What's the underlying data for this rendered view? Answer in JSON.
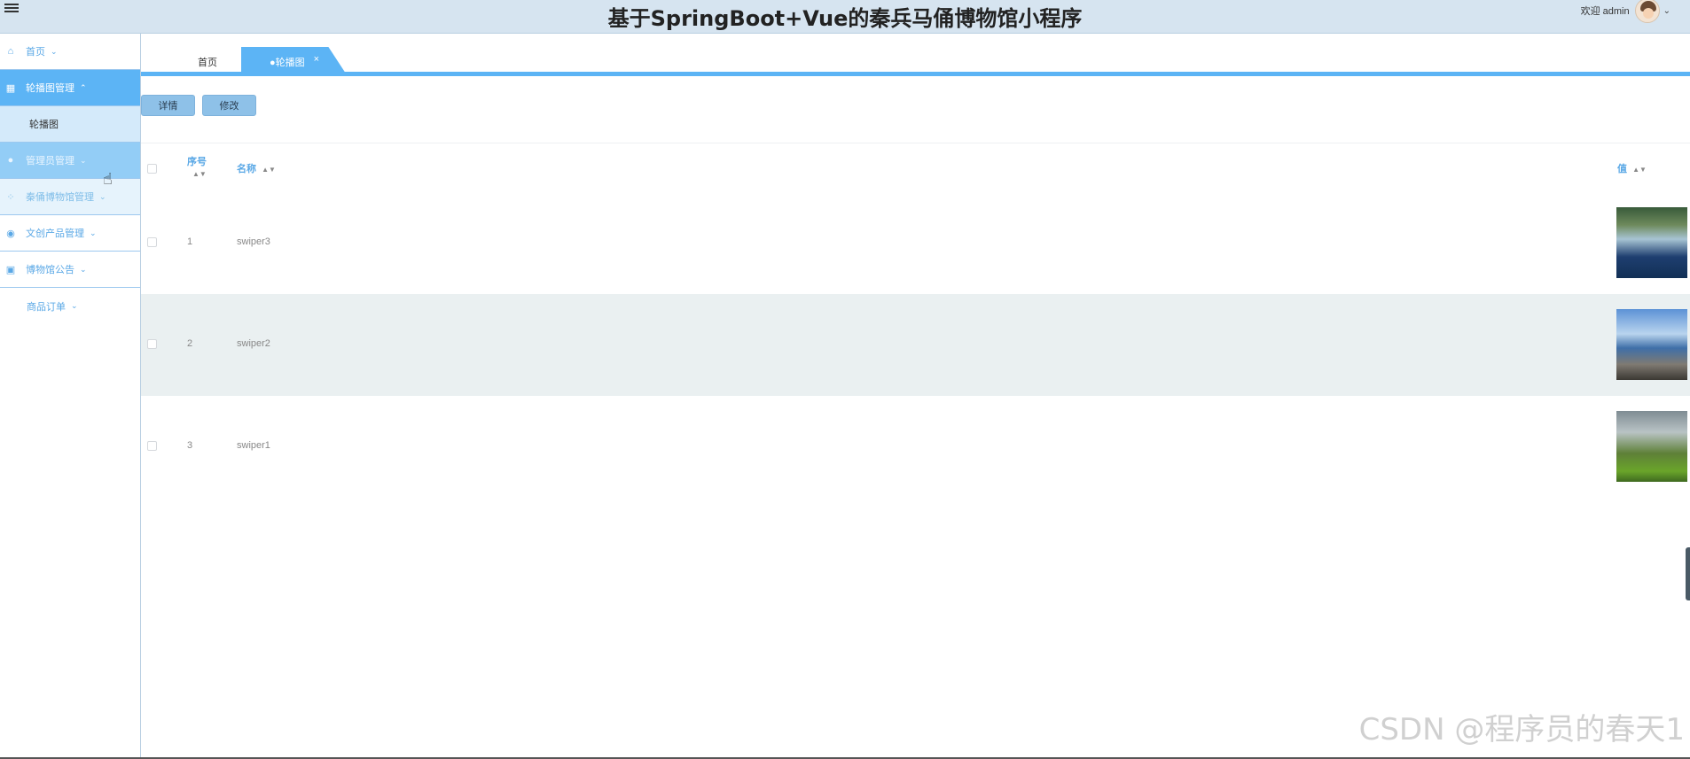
{
  "app": {
    "title": "基于SpringBoot+Vue的秦兵马俑博物馆小程序",
    "welcome": "欢迎 admin"
  },
  "sidebar": {
    "items": [
      {
        "label": "首页",
        "icon": "home-icon"
      },
      {
        "label": "轮播图管理",
        "icon": "grid-icon"
      },
      {
        "label": "轮播图",
        "icon": ""
      },
      {
        "label": "管理员管理",
        "icon": "user-icon"
      },
      {
        "label": "秦俑博物馆管理",
        "icon": "apps-icon"
      },
      {
        "label": "文创产品管理",
        "icon": "circle-icon"
      },
      {
        "label": "博物馆公告",
        "icon": "notice-icon"
      },
      {
        "label": "商品订单",
        "icon": ""
      }
    ]
  },
  "tabs": {
    "home": "首页",
    "active": "●轮播图",
    "close": "×"
  },
  "toolbar": {
    "detail": "详情",
    "edit": "修改"
  },
  "table": {
    "headers": {
      "index": "序号",
      "name": "名称",
      "value": "值"
    },
    "rows": [
      {
        "index": "1",
        "name": "swiper3"
      },
      {
        "index": "2",
        "name": "swiper2"
      },
      {
        "index": "3",
        "name": "swiper1"
      }
    ]
  },
  "watermark": "CSDN @程序员的春天1"
}
